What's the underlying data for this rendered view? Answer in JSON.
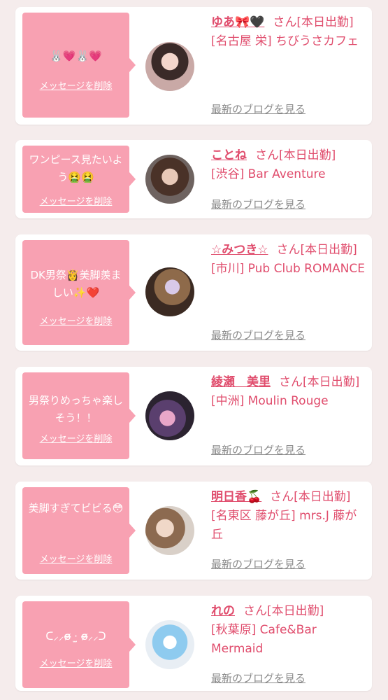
{
  "colors": {
    "accent": "#e04d6d",
    "bubble": "#f8a1b2",
    "background": "#f5ecec"
  },
  "delete_label": "メッセージを削除",
  "blog_label": "最新のブログを見る",
  "cards": [
    {
      "message": "🐰💗🐰💗",
      "name": "ゆあ🎀🖤",
      "suffix": "さん[本日出勤]",
      "location": "[名古屋 栄] ちびうさカフェ"
    },
    {
      "message": "ワンピース見たいよう🤮🤮",
      "name": "ことね",
      "suffix": "さん[本日出勤]",
      "location": "[渋谷] Bar Aventure"
    },
    {
      "message": "DK男祭👸美脚羨ましい✨❤️",
      "name": "☆みつき☆",
      "suffix": "さん[本日出勤]",
      "location": "[市川] Pub Club ROMANCE"
    },
    {
      "message": "男祭りめっちゃ楽しそう！！",
      "name": "綾瀬　美里",
      "suffix": "さん[本日出勤]",
      "location": "[中洲] Moulin Rouge"
    },
    {
      "message": "美脚すぎてビビる😳",
      "name": "明日香🍒",
      "suffix": "さん[本日出勤]",
      "location": "[名東区 藤が丘] mrs.J 藤が丘"
    },
    {
      "message": "ᑕ⸝⸝ɞ̴̶̷ ·̫ ɞ̴̶̷⸝⸝ᑐ",
      "name": "れの",
      "suffix": "さん[本日出勤]",
      "location": "[秋葉原] Cafe&Bar Mermaid"
    }
  ]
}
